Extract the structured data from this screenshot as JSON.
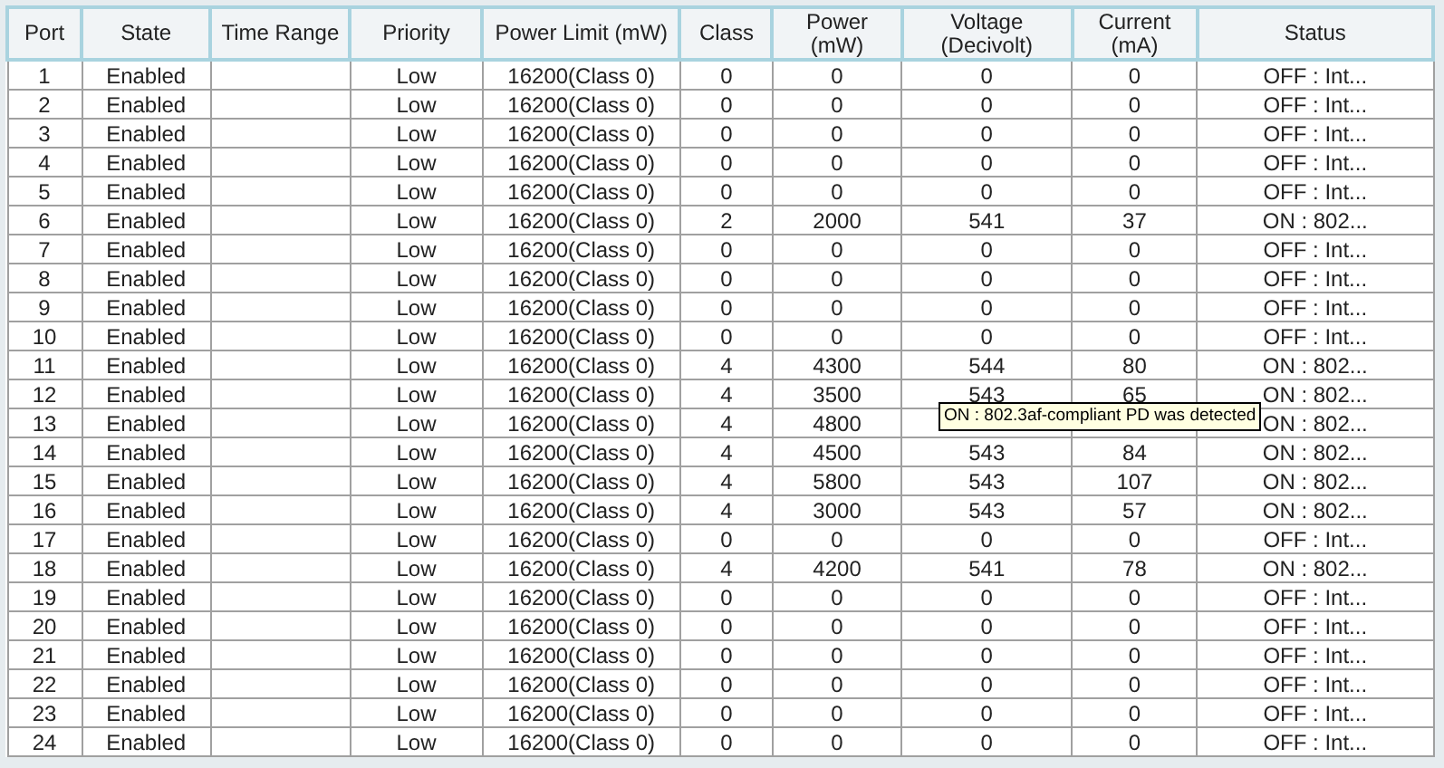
{
  "table": {
    "columns": [
      "Port",
      "State",
      "Time Range",
      "Priority",
      "Power Limit (mW)",
      "Class",
      "Power\n(mW)",
      "Voltage\n(Decivolt)",
      "Current\n(mA)",
      "Status"
    ],
    "rows": [
      {
        "port": "1",
        "state": "Enabled",
        "priority": "Low",
        "power_limit": "16200(Class 0)",
        "class": "0",
        "power": "0",
        "voltage": "0",
        "current": "0",
        "status": "OFF : Int..."
      },
      {
        "port": "2",
        "state": "Enabled",
        "priority": "Low",
        "power_limit": "16200(Class 0)",
        "class": "0",
        "power": "0",
        "voltage": "0",
        "current": "0",
        "status": "OFF : Int..."
      },
      {
        "port": "3",
        "state": "Enabled",
        "priority": "Low",
        "power_limit": "16200(Class 0)",
        "class": "0",
        "power": "0",
        "voltage": "0",
        "current": "0",
        "status": "OFF : Int..."
      },
      {
        "port": "4",
        "state": "Enabled",
        "priority": "Low",
        "power_limit": "16200(Class 0)",
        "class": "0",
        "power": "0",
        "voltage": "0",
        "current": "0",
        "status": "OFF : Int..."
      },
      {
        "port": "5",
        "state": "Enabled",
        "priority": "Low",
        "power_limit": "16200(Class 0)",
        "class": "0",
        "power": "0",
        "voltage": "0",
        "current": "0",
        "status": "OFF : Int..."
      },
      {
        "port": "6",
        "state": "Enabled",
        "priority": "Low",
        "power_limit": "16200(Class 0)",
        "class": "2",
        "power": "2000",
        "voltage": "541",
        "current": "37",
        "status": "ON : 802..."
      },
      {
        "port": "7",
        "state": "Enabled",
        "priority": "Low",
        "power_limit": "16200(Class 0)",
        "class": "0",
        "power": "0",
        "voltage": "0",
        "current": "0",
        "status": "OFF : Int..."
      },
      {
        "port": "8",
        "state": "Enabled",
        "priority": "Low",
        "power_limit": "16200(Class 0)",
        "class": "0",
        "power": "0",
        "voltage": "0",
        "current": "0",
        "status": "OFF : Int..."
      },
      {
        "port": "9",
        "state": "Enabled",
        "priority": "Low",
        "power_limit": "16200(Class 0)",
        "class": "0",
        "power": "0",
        "voltage": "0",
        "current": "0",
        "status": "OFF : Int..."
      },
      {
        "port": "10",
        "state": "Enabled",
        "priority": "Low",
        "power_limit": "16200(Class 0)",
        "class": "0",
        "power": "0",
        "voltage": "0",
        "current": "0",
        "status": "OFF : Int..."
      },
      {
        "port": "11",
        "state": "Enabled",
        "priority": "Low",
        "power_limit": "16200(Class 0)",
        "class": "4",
        "power": "4300",
        "voltage": "544",
        "current": "80",
        "status": "ON : 802..."
      },
      {
        "port": "12",
        "state": "Enabled",
        "priority": "Low",
        "power_limit": "16200(Class 0)",
        "class": "4",
        "power": "3500",
        "voltage": "543",
        "current": "65",
        "status": "ON : 802..."
      },
      {
        "port": "13",
        "state": "Enabled",
        "priority": "Low",
        "power_limit": "16200(Class 0)",
        "class": "4",
        "power": "4800",
        "status": "ON : 802..."
      },
      {
        "port": "14",
        "state": "Enabled",
        "priority": "Low",
        "power_limit": "16200(Class 0)",
        "class": "4",
        "power": "4500",
        "voltage": "543",
        "current": "84",
        "status": "ON : 802..."
      },
      {
        "port": "15",
        "state": "Enabled",
        "priority": "Low",
        "power_limit": "16200(Class 0)",
        "class": "4",
        "power": "5800",
        "voltage": "543",
        "current": "107",
        "status": "ON : 802..."
      },
      {
        "port": "16",
        "state": "Enabled",
        "priority": "Low",
        "power_limit": "16200(Class 0)",
        "class": "4",
        "power": "3000",
        "voltage": "543",
        "current": "57",
        "status": "ON : 802..."
      },
      {
        "port": "17",
        "state": "Enabled",
        "priority": "Low",
        "power_limit": "16200(Class 0)",
        "class": "0",
        "power": "0",
        "voltage": "0",
        "current": "0",
        "status": "OFF : Int..."
      },
      {
        "port": "18",
        "state": "Enabled",
        "priority": "Low",
        "power_limit": "16200(Class 0)",
        "class": "4",
        "power": "4200",
        "voltage": "541",
        "current": "78",
        "status": "ON : 802..."
      },
      {
        "port": "19",
        "state": "Enabled",
        "priority": "Low",
        "power_limit": "16200(Class 0)",
        "class": "0",
        "power": "0",
        "voltage": "0",
        "current": "0",
        "status": "OFF : Int..."
      },
      {
        "port": "20",
        "state": "Enabled",
        "priority": "Low",
        "power_limit": "16200(Class 0)",
        "class": "0",
        "power": "0",
        "voltage": "0",
        "current": "0",
        "status": "OFF : Int..."
      },
      {
        "port": "21",
        "state": "Enabled",
        "priority": "Low",
        "power_limit": "16200(Class 0)",
        "class": "0",
        "power": "0",
        "voltage": "0",
        "current": "0",
        "status": "OFF : Int..."
      },
      {
        "port": "22",
        "state": "Enabled",
        "priority": "Low",
        "power_limit": "16200(Class 0)",
        "class": "0",
        "power": "0",
        "voltage": "0",
        "current": "0",
        "status": "OFF : Int..."
      },
      {
        "port": "23",
        "state": "Enabled",
        "priority": "Low",
        "power_limit": "16200(Class 0)",
        "class": "0",
        "power": "0",
        "voltage": "0",
        "current": "0",
        "status": "OFF : Int..."
      },
      {
        "port": "24",
        "state": "Enabled",
        "priority": "Low",
        "power_limit": "16200(Class 0)",
        "class": "0",
        "power": "0",
        "voltage": "0",
        "current": "0",
        "status": "OFF : Int..."
      }
    ]
  },
  "tooltip": {
    "text": "ON : 802.3af-compliant PD was detected"
  }
}
